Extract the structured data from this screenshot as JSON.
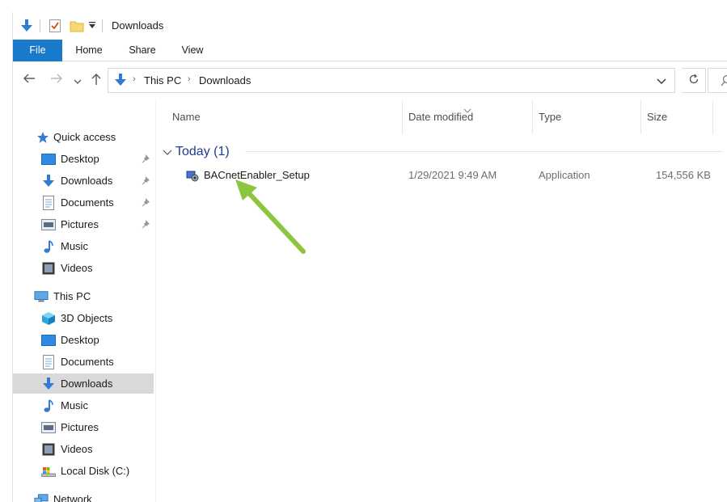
{
  "window": {
    "title": "Downloads"
  },
  "ribbon": {
    "tabs": [
      {
        "label": "File",
        "active": true
      },
      {
        "label": "Home"
      },
      {
        "label": "Share"
      },
      {
        "label": "View"
      }
    ]
  },
  "address": {
    "breadcrumbs": [
      "This PC",
      "Downloads"
    ]
  },
  "sidebar": {
    "quick_access": {
      "label": "Quick access",
      "items": [
        {
          "label": "Desktop",
          "icon": "desktop-icon",
          "pinned": true
        },
        {
          "label": "Downloads",
          "icon": "downloads-icon",
          "pinned": true
        },
        {
          "label": "Documents",
          "icon": "documents-icon",
          "pinned": true
        },
        {
          "label": "Pictures",
          "icon": "pictures-icon",
          "pinned": true
        },
        {
          "label": "Music",
          "icon": "music-icon",
          "pinned": false
        },
        {
          "label": "Videos",
          "icon": "videos-icon",
          "pinned": false
        }
      ]
    },
    "this_pc": {
      "label": "This PC",
      "items": [
        {
          "label": "3D Objects",
          "icon": "3d-objects-icon"
        },
        {
          "label": "Desktop",
          "icon": "desktop-icon"
        },
        {
          "label": "Documents",
          "icon": "documents-icon"
        },
        {
          "label": "Downloads",
          "icon": "downloads-icon",
          "selected": true
        },
        {
          "label": "Music",
          "icon": "music-icon"
        },
        {
          "label": "Pictures",
          "icon": "pictures-icon"
        },
        {
          "label": "Videos",
          "icon": "videos-icon"
        },
        {
          "label": "Local Disk (C:)",
          "icon": "drive-icon"
        }
      ]
    },
    "network": {
      "label": "Network"
    }
  },
  "file_list": {
    "columns": [
      "Name",
      "Date modified",
      "Type",
      "Size"
    ],
    "group": {
      "label": "Today (1)"
    },
    "rows": [
      {
        "name": "BACnetEnabler_Setup",
        "date_modified": "1/29/2021 9:49 AM",
        "type": "Application",
        "size": "154,556 KB"
      }
    ]
  },
  "colors": {
    "file_tab": "#1979ca",
    "download_arrow": "#2f7bd6",
    "annotation_arrow": "#8cc63f",
    "group_label": "#1e3d8f",
    "selected_bg": "#d9d9d9"
  }
}
